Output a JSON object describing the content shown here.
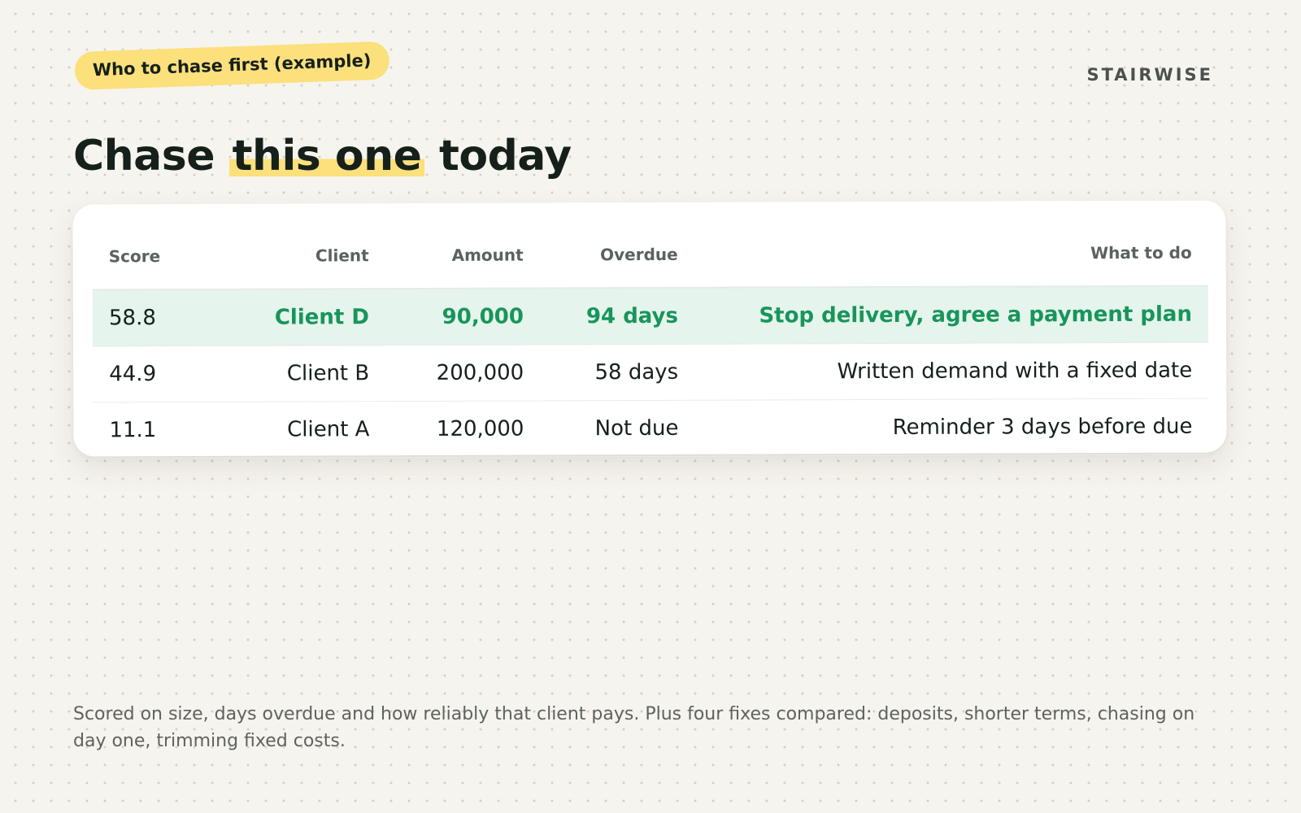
{
  "header": {
    "tag": "Who to chase first (example)",
    "brand": "STAIRWISE"
  },
  "headline": {
    "before": "Chase",
    "highlight": "this one",
    "after": "today"
  },
  "colors": {
    "highlight": "#fbe07c",
    "accent_green": "#18955b",
    "top_row_bg": "#e5f4ec",
    "background": "#f6f4ee"
  },
  "table": {
    "columns": [
      "Score",
      "Client",
      "Amount",
      "Overdue",
      "What to do"
    ],
    "rows": [
      {
        "score": "58.8",
        "client": "Client D",
        "amount": "90,000",
        "overdue": "94 days",
        "action": "Stop delivery, agree a payment plan",
        "highlighted": true
      },
      {
        "score": "44.9",
        "client": "Client B",
        "amount": "200,000",
        "overdue": "58 days",
        "action": "Written demand with a fixed date",
        "highlighted": false
      },
      {
        "score": "11.1",
        "client": "Client A",
        "amount": "120,000",
        "overdue": "Not due",
        "action": "Reminder 3 days before due",
        "highlighted": false
      }
    ]
  },
  "footnote": "Scored on size, days overdue and how reliably that client pays. Plus four fixes compared: deposits, shorter terms, chasing on day one, trimming fixed costs."
}
